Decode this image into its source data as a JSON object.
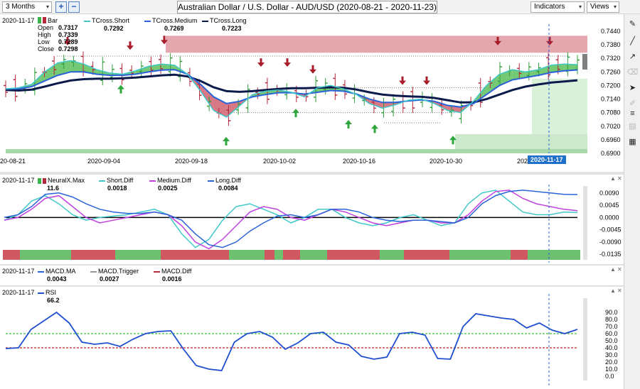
{
  "toolbar": {
    "timeframe": "3 Months",
    "plus": "+",
    "minus": "−",
    "title": "Australian Dollar / U.S. Dollar - AUD/USD (2020-08-21 - 2020-11-23)",
    "indicators": "Indicators",
    "views": "Views",
    "arrow": "▾"
  },
  "tools": {
    "icons": [
      "pencil-icon",
      "line-icon",
      "ray-icon",
      "eraser-icon",
      "pointer-icon",
      "brush-icon",
      "fibonacci-icon",
      "chart-mode-icon",
      "calendar-icon"
    ]
  },
  "price": {
    "date": "2020-11-17",
    "bar_label": "Bar",
    "open_label": "Open",
    "open": "0.7317",
    "high_label": "High",
    "high": "0.7339",
    "low_label": "Low",
    "low": "0.7289",
    "close_label": "Close",
    "close": "0.7298",
    "short_label": "TCross.Short",
    "short": "0.7292",
    "medium_label": "TCross.Medium",
    "medium": "0.7269",
    "long_label": "TCross.Long",
    "long": "0.7223",
    "y_ticks": [
      "0.7440",
      "0.7380",
      "0.7320",
      "0.7260",
      "0.7200",
      "0.7140",
      "0.7080",
      "0.7020",
      "0.6960",
      "0.6900"
    ],
    "x_ticks": [
      "20-08-21",
      "2020-09-04",
      "2020-09-18",
      "2020-10-02",
      "2020-10-16",
      "2020-10-30",
      "202"
    ],
    "x_badge": "2020-11-17"
  },
  "neural": {
    "date": "2020-11-17",
    "max_label": "NeuralX.Max",
    "max": "11.6",
    "short_label": "Short.Diff",
    "short": "0.0018",
    "medium_label": "Medium.Diff",
    "medium": "0.0025",
    "long_label": "Long.Diff",
    "long": "0.0084",
    "y_ticks": [
      "0.0090",
      "0.0045",
      "0.0000",
      "-0.0045",
      "-0.0090",
      "-0.0135"
    ]
  },
  "macd": {
    "date": "2020-11-17",
    "ma_label": "MACD.MA",
    "ma": "0.0043",
    "trigger_label": "MACD.Trigger",
    "trigger": "0.0027",
    "diff_label": "MACD.Diff",
    "diff": "0.0016"
  },
  "rsi": {
    "date": "2020-11-17",
    "label": "RSI",
    "value": "66.2",
    "y_ticks": [
      "90.0",
      "80.0",
      "70.0",
      "60.0",
      "50.0",
      "40.0",
      "30.0",
      "20.0",
      "10.0",
      "0.0"
    ]
  },
  "colors": {
    "green": "#3cb34a",
    "red": "#b3283a",
    "short": "#40c8c8",
    "medium": "#2a63d8",
    "long": "#0a1a4a",
    "purple": "#c040e0",
    "rsi": "#1f4fd0"
  },
  "chart_data": [
    {
      "type": "line",
      "title": "Australian Dollar / U.S. Dollar - AUD/USD (2020-08-21 - 2020-11-23)",
      "x_ticks": [
        "20-08-21",
        "2020-09-04",
        "2020-09-18",
        "2020-10-02",
        "2020-10-16",
        "2020-10-30",
        "2020-11-17"
      ],
      "ylim": [
        0.69,
        0.744
      ],
      "series": [
        {
          "name": "TCross.Short",
          "values": [
            0.7185,
            0.719,
            0.7205,
            0.726,
            0.73,
            0.731,
            0.7295,
            0.727,
            0.7255,
            0.725,
            0.7265,
            0.7285,
            0.7295,
            0.729,
            0.725,
            0.7175,
            0.709,
            0.706,
            0.711,
            0.716,
            0.7175,
            0.718,
            0.717,
            0.715,
            0.719,
            0.72,
            0.7185,
            0.716,
            0.712,
            0.71,
            0.7115,
            0.7135,
            0.714,
            0.712,
            0.709,
            0.708,
            0.713,
            0.72,
            0.725,
            0.727,
            0.726,
            0.727,
            0.729,
            0.7295,
            0.7292
          ]
        },
        {
          "name": "TCross.Medium",
          "values": [
            0.7185,
            0.7185,
            0.7195,
            0.722,
            0.7245,
            0.726,
            0.726,
            0.725,
            0.7245,
            0.7245,
            0.725,
            0.726,
            0.7268,
            0.727,
            0.725,
            0.7205,
            0.715,
            0.712,
            0.713,
            0.715,
            0.716,
            0.7168,
            0.7168,
            0.7162,
            0.717,
            0.7178,
            0.7175,
            0.7162,
            0.714,
            0.7125,
            0.7125,
            0.7132,
            0.7136,
            0.713,
            0.7112,
            0.7105,
            0.712,
            0.716,
            0.72,
            0.7225,
            0.7235,
            0.7245,
            0.7258,
            0.7265,
            0.7269
          ]
        },
        {
          "name": "TCross.Long",
          "values": [
            0.718,
            0.7178,
            0.7182,
            0.7195,
            0.721,
            0.7222,
            0.7228,
            0.723,
            0.723,
            0.7232,
            0.7235,
            0.724,
            0.7245,
            0.7248,
            0.724,
            0.722,
            0.7192,
            0.7175,
            0.7172,
            0.7175,
            0.718,
            0.7185,
            0.7188,
            0.7188,
            0.719,
            0.7192,
            0.719,
            0.7182,
            0.717,
            0.716,
            0.7155,
            0.7152,
            0.715,
            0.7145,
            0.7135,
            0.7125,
            0.7125,
            0.714,
            0.716,
            0.718,
            0.7195,
            0.7205,
            0.7213,
            0.7218,
            0.7223
          ]
        }
      ]
    },
    {
      "type": "line",
      "ylim": [
        -0.015,
        0.0105
      ],
      "series": [
        {
          "name": "Short.Diff",
          "values": [
            -0.001,
            0.001,
            0.006,
            0.008,
            0.005,
            0.001,
            -0.001,
            0.0,
            0.0005,
            0.001,
            0.002,
            0.003,
            0.001,
            -0.006,
            -0.011,
            -0.008,
            -0.001,
            0.004,
            0.005,
            0.003,
            0.001,
            -0.002,
            0.0,
            0.003,
            0.003,
            0.0,
            -0.002,
            -0.003,
            -0.002,
            0.0,
            0.001,
            -0.001,
            -0.003,
            -0.002,
            0.005,
            0.009,
            0.01,
            0.006,
            0.002,
            0.001,
            0.001,
            0.002,
            0.0018
          ]
        },
        {
          "name": "Medium.Diff",
          "values": [
            -0.001,
            0.0,
            0.003,
            0.007,
            0.008,
            0.004,
            0.0,
            -0.002,
            -0.001,
            0.0,
            0.001,
            0.002,
            0.001,
            -0.003,
            -0.009,
            -0.0115,
            -0.008,
            -0.003,
            0.002,
            0.004,
            0.003,
            0.0,
            -0.001,
            0.001,
            0.003,
            0.002,
            0.0,
            -0.002,
            -0.003,
            -0.002,
            -0.001,
            -0.001,
            -0.002,
            -0.002,
            0.001,
            0.006,
            0.0095,
            0.01,
            0.007,
            0.005,
            0.004,
            0.003,
            0.0025
          ]
        },
        {
          "name": "Long.Diff",
          "values": [
            0.0,
            0.001,
            0.004,
            0.0085,
            0.009,
            0.0075,
            0.005,
            0.003,
            0.002,
            0.0015,
            0.0015,
            0.002,
            0.001,
            -0.001,
            -0.006,
            -0.01,
            -0.011,
            -0.009,
            -0.005,
            -0.002,
            0.0005,
            0.001,
            0.0,
            0.001,
            0.003,
            0.003,
            0.002,
            0.0,
            -0.001,
            -0.0015,
            -0.001,
            -0.001,
            -0.0015,
            -0.002,
            0.0,
            0.005,
            0.008,
            0.0095,
            0.01,
            0.0095,
            0.009,
            0.0085,
            0.0084
          ]
        }
      ]
    },
    {
      "type": "line",
      "title": "RSI",
      "ylim": [
        0,
        100
      ],
      "series": [
        {
          "name": "RSI",
          "values": [
            39,
            40,
            66,
            78,
            90,
            75,
            48,
            45,
            47,
            42,
            52,
            60,
            63,
            64,
            38,
            15,
            10,
            8,
            48,
            60,
            63,
            55,
            38,
            47,
            60,
            62,
            48,
            44,
            28,
            24,
            27,
            60,
            62,
            58,
            25,
            24,
            70,
            88,
            85,
            82,
            80,
            68,
            75,
            65,
            60,
            66
          ]
        }
      ]
    }
  ]
}
